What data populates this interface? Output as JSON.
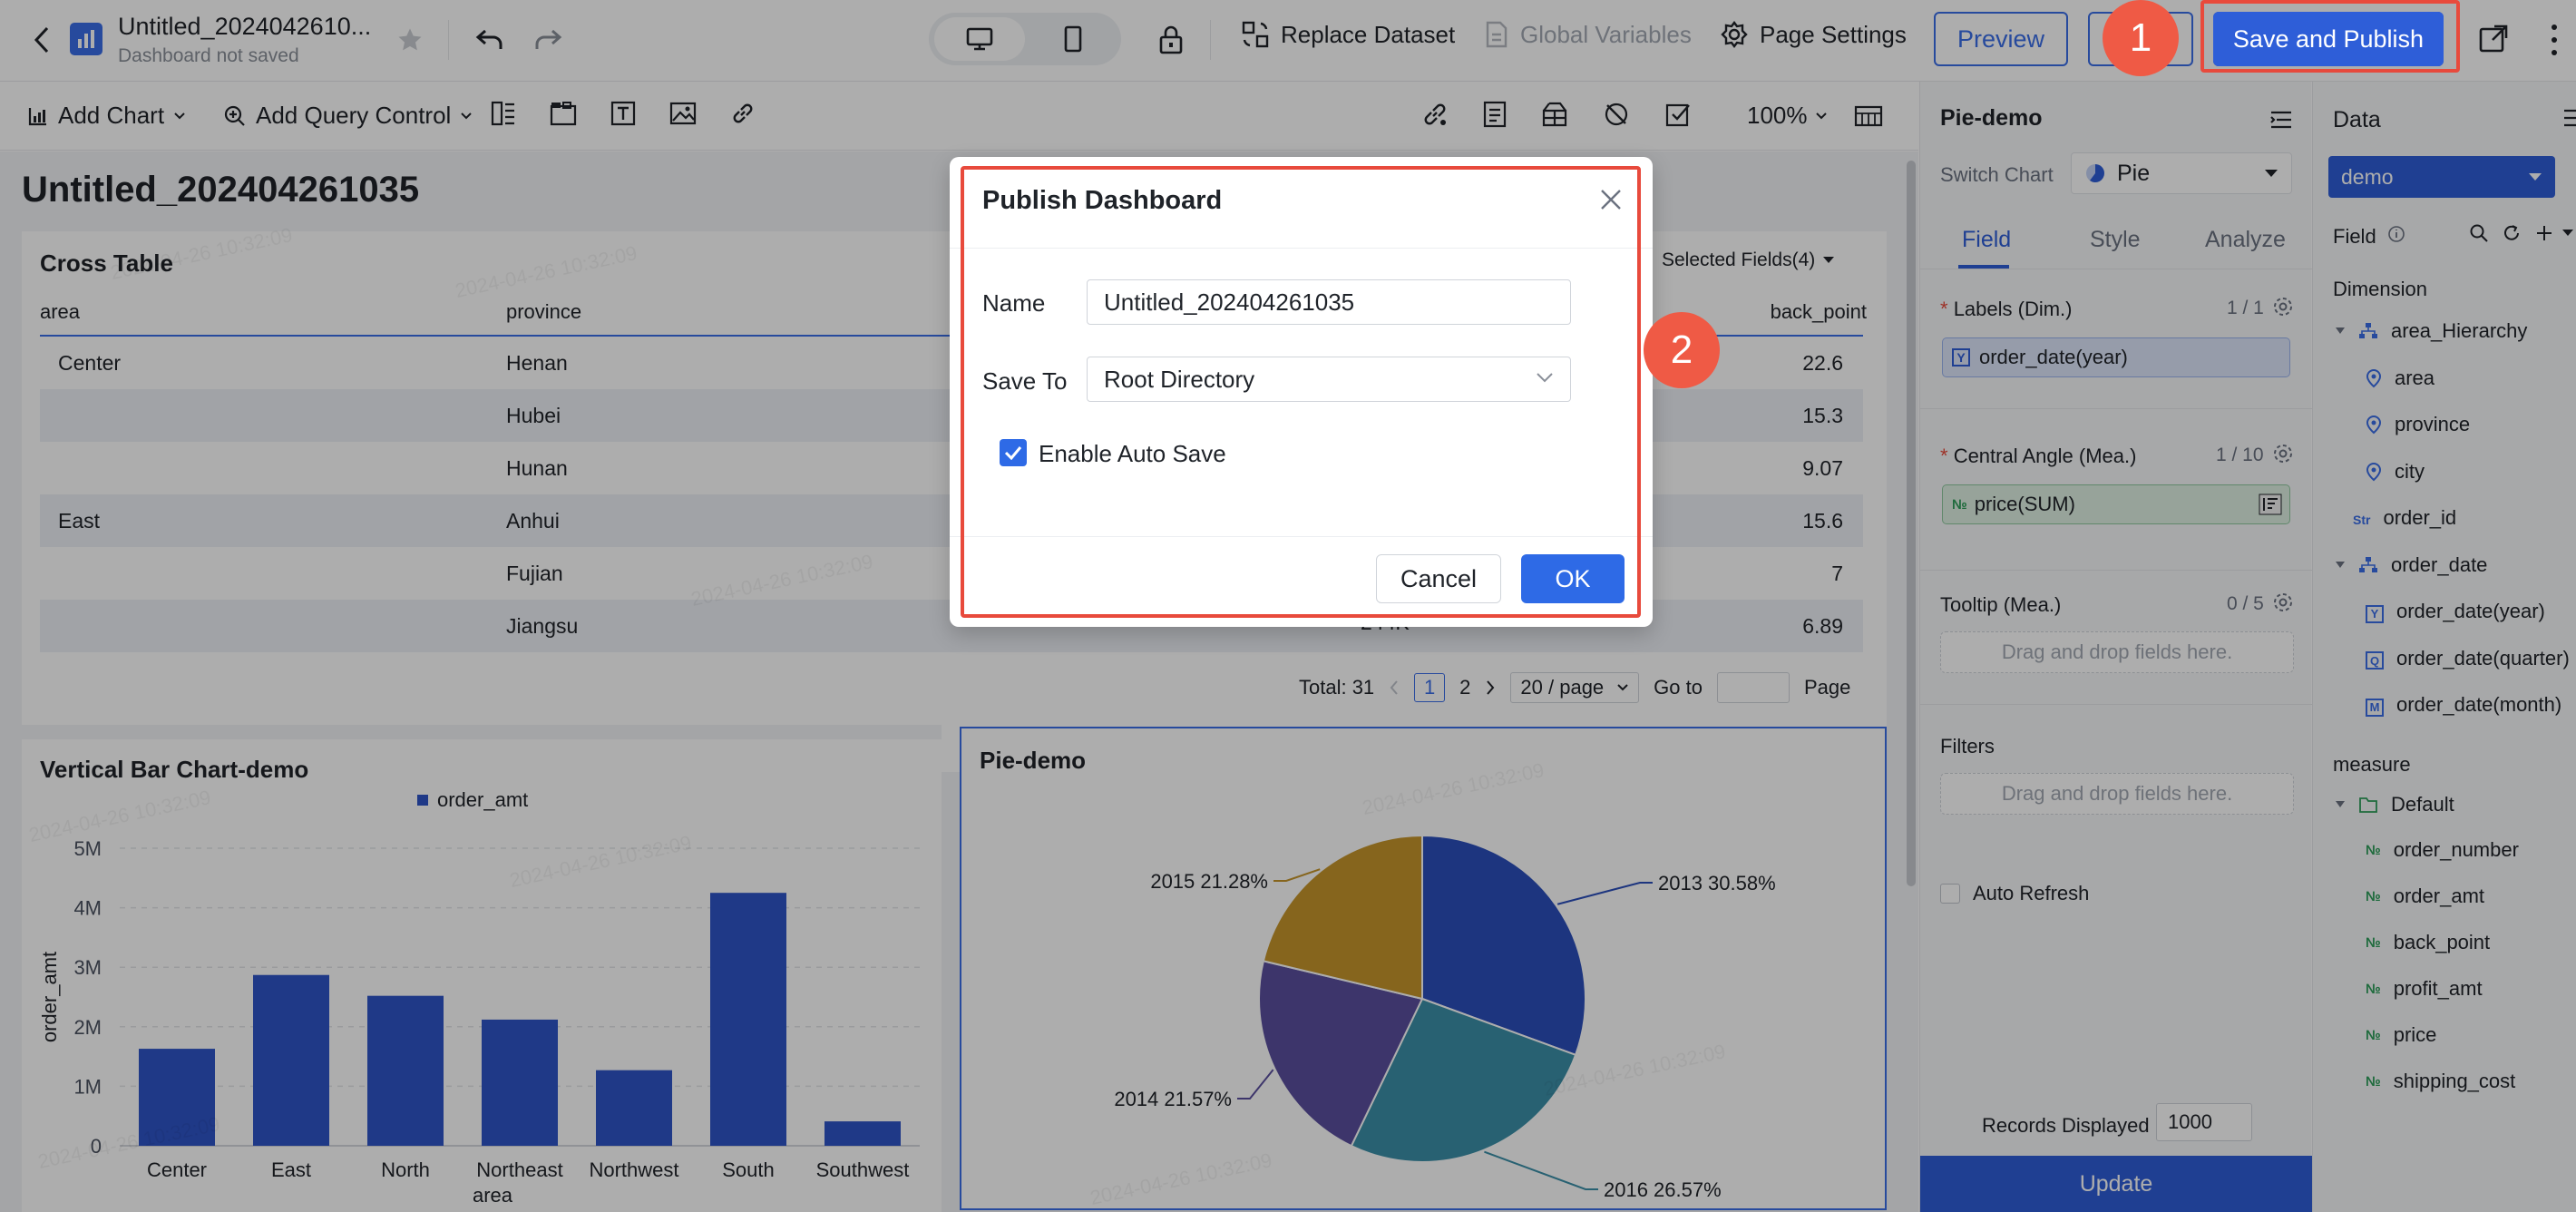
{
  "app": {
    "title": "Untitled_2024042610...",
    "subtitle": "Dashboard not saved",
    "brand_color": "#3a6ee8"
  },
  "topbar": {
    "replace_dataset": "Replace Dataset",
    "global_variables": "Global Variables",
    "page_settings": "Page Settings",
    "preview": "Preview",
    "save_publish": "Save and Publish",
    "icons": [
      "back-icon",
      "dashboard-logo-icon",
      "star-icon",
      "undo-icon",
      "redo-icon",
      "desktop-icon",
      "mobile-icon",
      "lock-icon",
      "replace-dataset-icon",
      "global-variables-icon",
      "page-settings-icon",
      "share-icon",
      "more-icon"
    ]
  },
  "toolbar": {
    "add_chart": "Add Chart",
    "add_query_control": "Add Query Control",
    "zoom": "100%"
  },
  "dashboard": {
    "title": "Untitled_202404261035"
  },
  "cross_table": {
    "title": "Cross Table",
    "selected_fields": "Selected Fields(4)",
    "columns": [
      "area",
      "province",
      "back_point"
    ],
    "rows": [
      {
        "area": "Center",
        "province": "Henan",
        "back_point": "22.6"
      },
      {
        "area": "",
        "province": "Hubei",
        "back_point": "15.3"
      },
      {
        "area": "",
        "province": "Hunan",
        "back_point": "9.07"
      },
      {
        "area": "East",
        "province": "Anhui",
        "back_point": "15.6"
      },
      {
        "area": "",
        "province": "Fujian",
        "back_point": "7"
      },
      {
        "area": "",
        "province": "Jiangsu",
        "back_point": "6.89"
      }
    ],
    "partial_value": "244K",
    "pagination": {
      "total": "Total: 31",
      "page1": "1",
      "page2": "2",
      "per_page": "20 / page",
      "goto": "Go to",
      "page_word": "Page"
    }
  },
  "watermark": "2024-04-26 10:32:09",
  "bar_chart": {
    "title": "Vertical Bar Chart-demo",
    "legend": "order_amt",
    "ylabel": "order_amt",
    "xlabel": "area",
    "yticks": [
      "0",
      "1M",
      "2M",
      "3M",
      "4M",
      "5M"
    ]
  },
  "pie_chart": {
    "title": "Pie-demo",
    "labels": [
      "2013 30.58%",
      "2016 26.57%",
      "2014 21.57%",
      "2015 21.28%"
    ]
  },
  "chart_data": [
    {
      "type": "bar",
      "title": "Vertical Bar Chart-demo",
      "xlabel": "area",
      "ylabel": "order_amt",
      "categories": [
        "Center",
        "East",
        "North",
        "Northeast",
        "Northwest",
        "South",
        "Southwest"
      ],
      "series": [
        {
          "name": "order_amt",
          "values": [
            1630000,
            2870000,
            2520000,
            2120000,
            1270000,
            4250000,
            410000
          ],
          "color": "#2f54c7"
        }
      ],
      "ylim": [
        0,
        5000000
      ],
      "grid": true,
      "legend": "top-center"
    },
    {
      "type": "pie",
      "title": "Pie-demo",
      "slices": [
        {
          "label": "2013",
          "percent": 30.58,
          "color": "#2b4fbc"
        },
        {
          "label": "2016",
          "percent": 26.57,
          "color": "#3b8fa8"
        },
        {
          "label": "2014",
          "percent": 21.57,
          "color": "#5a4f9e"
        },
        {
          "label": "2015",
          "percent": 21.28,
          "color": "#c6962b"
        }
      ]
    }
  ],
  "config_panel": {
    "title": "Pie-demo",
    "switch_chart": "Switch Chart",
    "chart_type": "Pie",
    "tabs": [
      "Field",
      "Style",
      "Analyze"
    ],
    "labels_dim": "Labels (Dim.)",
    "labels_count": "1 / 1",
    "labels_field": "order_date(year)",
    "angle_mea": "Central Angle (Mea.)",
    "angle_count": "1 / 10",
    "angle_field": "price(SUM)",
    "tooltip": "Tooltip (Mea.)",
    "tooltip_count": "0 / 5",
    "drop_hint": "Drag and drop fields here.",
    "filters": "Filters",
    "auto_refresh": "Auto Refresh",
    "records_displayed": "Records Displayed",
    "records_value": "1000",
    "update": "Update"
  },
  "data_panel": {
    "title": "Data",
    "dataset": "demo",
    "field_label": "Field",
    "dimension": "Dimension",
    "dims": [
      {
        "name": "area_Hierarchy",
        "type": "hier"
      },
      {
        "name": "area",
        "type": "geo"
      },
      {
        "name": "province",
        "type": "geo"
      },
      {
        "name": "city",
        "type": "geo"
      },
      {
        "name": "order_id",
        "type": "Str"
      },
      {
        "name": "order_date",
        "type": "hier"
      },
      {
        "name": "order_date(year)",
        "type": "Y"
      },
      {
        "name": "order_date(quarter)",
        "type": "Q"
      },
      {
        "name": "order_date(month)",
        "type": "M"
      }
    ],
    "measure": "measure",
    "measure_group": "Default",
    "measures": [
      "order_number",
      "order_amt",
      "back_point",
      "profit_amt",
      "price",
      "shipping_cost"
    ]
  },
  "modal": {
    "title": "Publish Dashboard",
    "name_label": "Name",
    "name_value": "Untitled_202404261035",
    "save_to_label": "Save To",
    "save_to_value": "Root Directory",
    "auto_save": "Enable Auto Save",
    "cancel": "Cancel",
    "ok": "OK"
  },
  "annotations": {
    "step1": "1",
    "step2": "2",
    "highlight_color": "#e84a3c"
  }
}
